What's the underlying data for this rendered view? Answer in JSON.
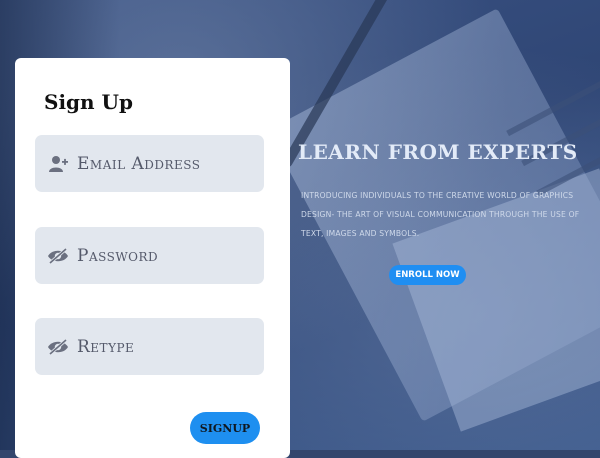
{
  "signup": {
    "title": "Sign Up",
    "email_placeholder": "Email Address",
    "password_placeholder": "Password",
    "retype_placeholder": "Retype",
    "submit_label": "SIGNUP"
  },
  "hero": {
    "headline": "LEARN FROM EXPERTS",
    "description": "INTRODUCING INDIVIDUALS TO THE CREATIVE WORLD OF GRAPHICS DESIGN- THE ART OF VISUAL COMMUNICATION THROUGH THE USE OF TEXT, IMAGES AND SYMBOLS.",
    "cta_label": "ENROLL NOW"
  },
  "icons": {
    "email": "add-user-icon",
    "password": "eye-slash-icon",
    "retype": "eye-slash-icon"
  },
  "colors": {
    "accent": "#1e8ff0",
    "field_bg": "#e2e7ee",
    "overlay": "#33466d"
  }
}
